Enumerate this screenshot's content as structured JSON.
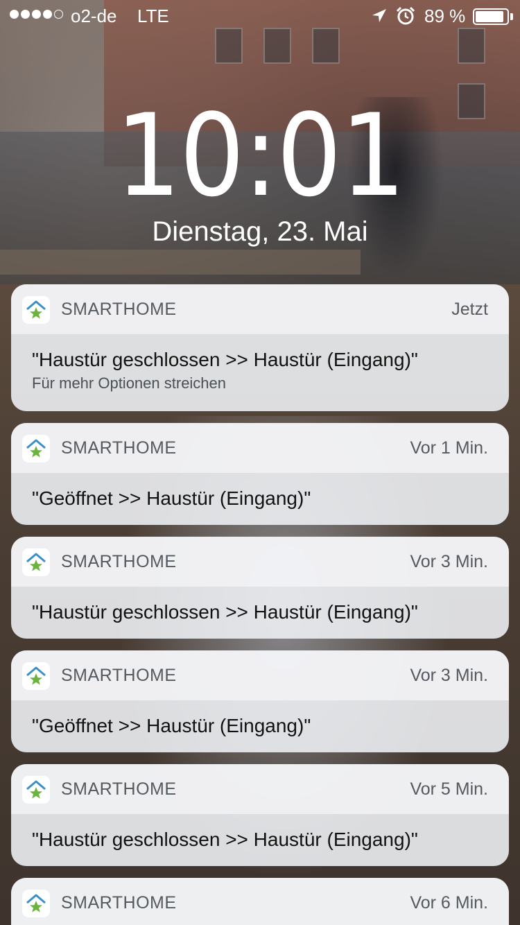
{
  "status_bar": {
    "carrier": "o2-de",
    "network": "LTE",
    "battery_percent": "89 %",
    "signal_bars": 4,
    "signal_total": 5,
    "icons": [
      "location-icon",
      "alarm-icon",
      "battery-icon"
    ]
  },
  "lock_screen": {
    "time": "10:01",
    "date": "Dienstag, 23. Mai"
  },
  "notifications": [
    {
      "app": "SMARTHOME",
      "time": "Jetzt",
      "message": "\"Haustür geschlossen >> Haustür (Eingang)\"",
      "hint": "Für mehr Optionen streichen"
    },
    {
      "app": "SMARTHOME",
      "time": "Vor 1 Min.",
      "message": "\"Geöffnet >> Haustür (Eingang)\""
    },
    {
      "app": "SMARTHOME",
      "time": "Vor 3 Min.",
      "message": "\"Haustür geschlossen >> Haustür (Eingang)\""
    },
    {
      "app": "SMARTHOME",
      "time": "Vor 3 Min.",
      "message": "\"Geöffnet >> Haustür (Eingang)\""
    },
    {
      "app": "SMARTHOME",
      "time": "Vor 5 Min.",
      "message": "\"Haustür geschlossen >> Haustür (Eingang)\""
    },
    {
      "app": "SMARTHOME",
      "time": "Vor 6 Min.",
      "message": ""
    }
  ],
  "colors": {
    "app_icon_roof": "#3a8fc7",
    "app_icon_star": "#6cb33f"
  }
}
